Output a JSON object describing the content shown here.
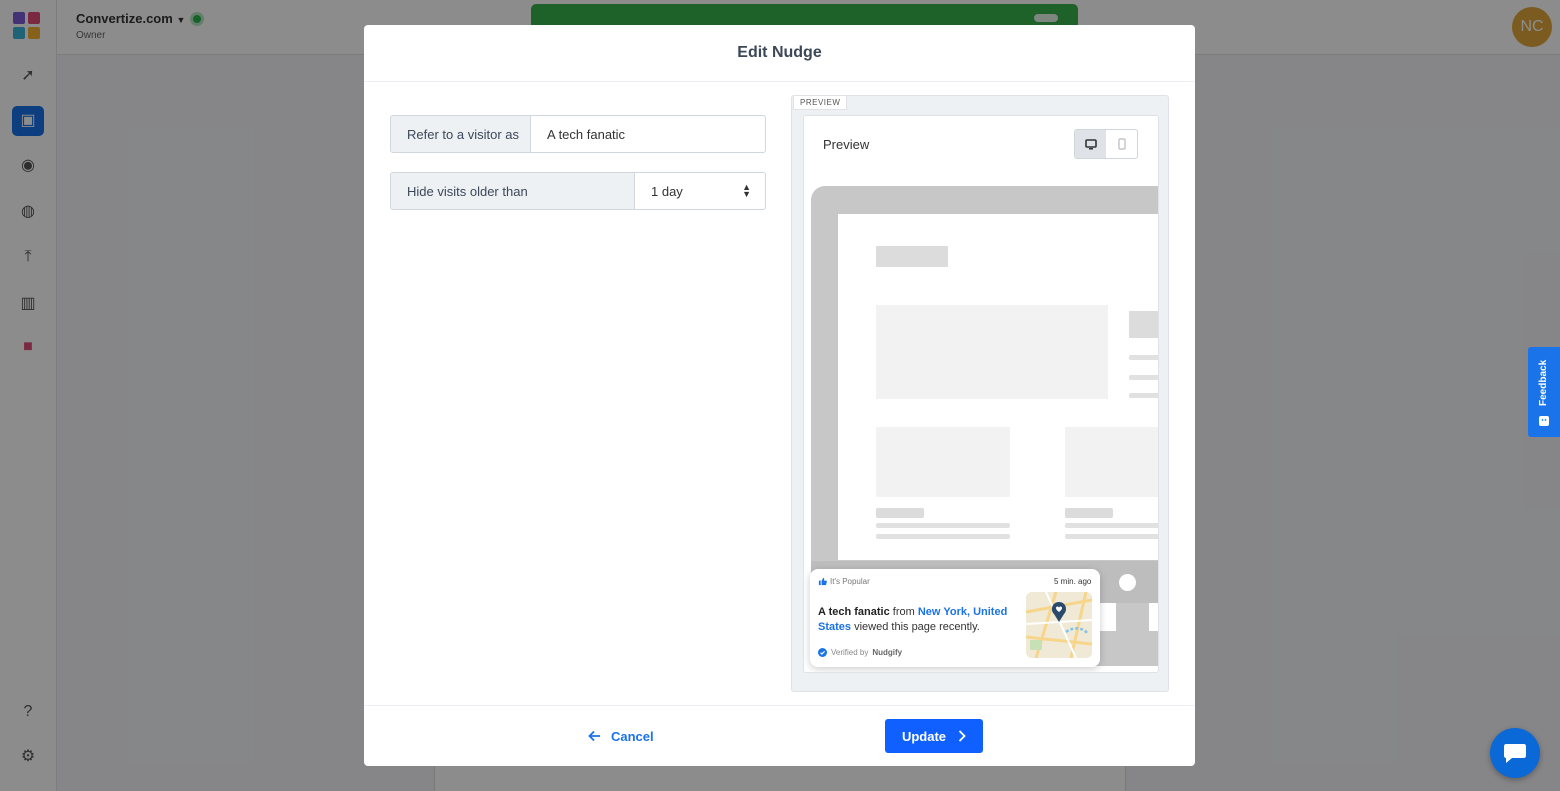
{
  "app": {
    "org_name": "Convertize.com",
    "org_role": "Owner",
    "avatar_initials": "NC",
    "banner_text": "",
    "banner_button": ""
  },
  "modal": {
    "title": "Edit Nudge",
    "fields": {
      "visitor_label": "Refer to a visitor as",
      "visitor_value": "A tech fanatic",
      "hide_label": "Hide visits older than",
      "hide_value": "1 day"
    },
    "preview": {
      "tag": "PREVIEW",
      "title": "Preview",
      "nudge": {
        "badge": "It's Popular",
        "time": "5 min. ago",
        "visitor": "A tech fanatic",
        "from_word": "from",
        "location": "New York, United States",
        "action": "viewed this page recently.",
        "verified_prefix": "Verified by",
        "verified_brand": "Nudgify"
      }
    },
    "cancel_label": "Cancel",
    "update_label": "Update"
  },
  "feedback_label": "Feedback",
  "colors": {
    "accent": "#1060ff",
    "link": "#1a73e8",
    "banner": "#37b24d",
    "avatar": "#e0a63a"
  }
}
